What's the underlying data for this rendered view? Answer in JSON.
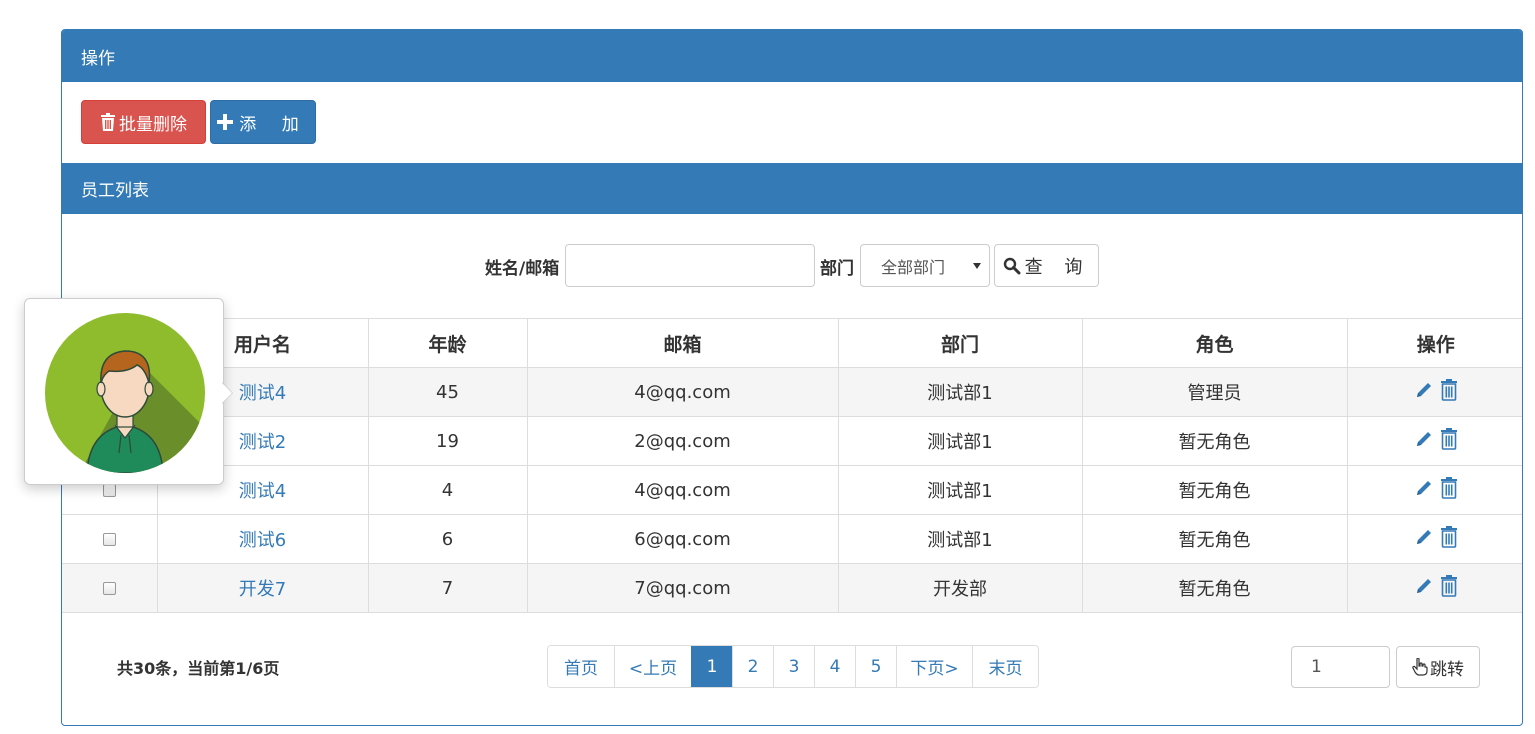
{
  "panel1": {
    "title": "操作"
  },
  "actions": {
    "batch_delete_label": "批量删除",
    "add_label": "添 加"
  },
  "panel2": {
    "title": "员工列表"
  },
  "search": {
    "name_email_label": "姓名/邮箱",
    "name_email_value": "",
    "dept_label": "部门",
    "dept_selected": "全部部门",
    "query_label": "查 询"
  },
  "table": {
    "headers": [
      "",
      "用户名",
      "年龄",
      "邮箱",
      "部门",
      "角色",
      "操作"
    ],
    "rows": [
      {
        "username": "测试4",
        "age": "45",
        "email": "4@qq.com",
        "dept": "测试部1",
        "role": "管理员"
      },
      {
        "username": "测试2",
        "age": "19",
        "email": "2@qq.com",
        "dept": "测试部1",
        "role": "暂无角色"
      },
      {
        "username": "测试4",
        "age": "4",
        "email": "4@qq.com",
        "dept": "测试部1",
        "role": "暂无角色"
      },
      {
        "username": "测试6",
        "age": "6",
        "email": "6@qq.com",
        "dept": "测试部1",
        "role": "暂无角色"
      },
      {
        "username": "开发7",
        "age": "7",
        "email": "7@qq.com",
        "dept": "开发部",
        "role": "暂无角色"
      }
    ]
  },
  "pagination": {
    "summary": "共30条，当前第1/6页",
    "items": [
      {
        "label": "首页",
        "active": false
      },
      {
        "label": "<上页",
        "active": false
      },
      {
        "label": "1",
        "active": true
      },
      {
        "label": "2",
        "active": false
      },
      {
        "label": "3",
        "active": false
      },
      {
        "label": "4",
        "active": false
      },
      {
        "label": "5",
        "active": false
      },
      {
        "label": "下页>",
        "active": false
      },
      {
        "label": "末页",
        "active": false
      }
    ],
    "jump_value": "1",
    "jump_label": "跳转"
  },
  "icons": {
    "trash": "trash-icon",
    "plus": "plus-icon",
    "search": "search-icon",
    "edit": "pencil-icon",
    "hand": "hand-pointer-icon",
    "avatar": "user-avatar"
  },
  "colors": {
    "primary": "#337ab7",
    "danger": "#d9534f",
    "avatar_bg": "#8fbc2d"
  }
}
